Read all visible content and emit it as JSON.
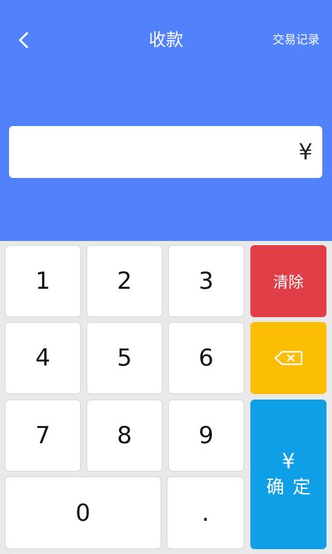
{
  "header": {
    "title": "收款",
    "history_link": "交易记录",
    "background_color": "#5282fb"
  },
  "amount": {
    "value": "",
    "currency_symbol": "¥"
  },
  "keypad": {
    "digits": [
      "1",
      "2",
      "3",
      "4",
      "5",
      "6",
      "7",
      "8",
      "9",
      "0",
      "."
    ],
    "clear_label": "清除",
    "clear_color": "#e23e48",
    "backspace_icon": "backspace-icon",
    "backspace_color": "#fbbe02",
    "confirm_symbol": "¥",
    "confirm_label": "确定",
    "confirm_color": "#0e9fe7"
  }
}
